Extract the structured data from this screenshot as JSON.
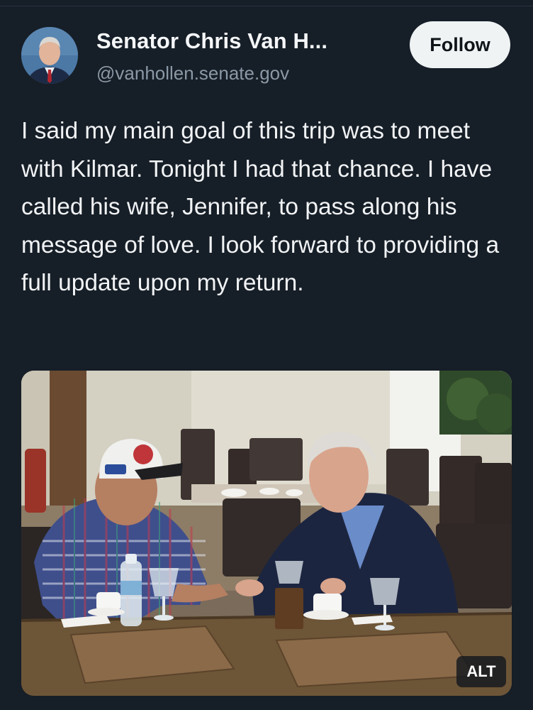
{
  "post": {
    "author": {
      "display_name": "Senator Chris Van H...",
      "handle": "@vanhollen.senate.gov"
    },
    "follow_label": "Follow",
    "text": "I said my main goal of this trip was to meet with Kilmar. Tonight I had that chance. I have called his wife, Jennifer, to pass along his message of love. I look forward to providing a full update upon my return.",
    "media": {
      "alt_label": "ALT"
    }
  },
  "colors": {
    "background": "#161e27",
    "text": "#f1f3f5",
    "secondary_text": "#8b98a5",
    "follow_button_bg": "#eff3f4"
  }
}
